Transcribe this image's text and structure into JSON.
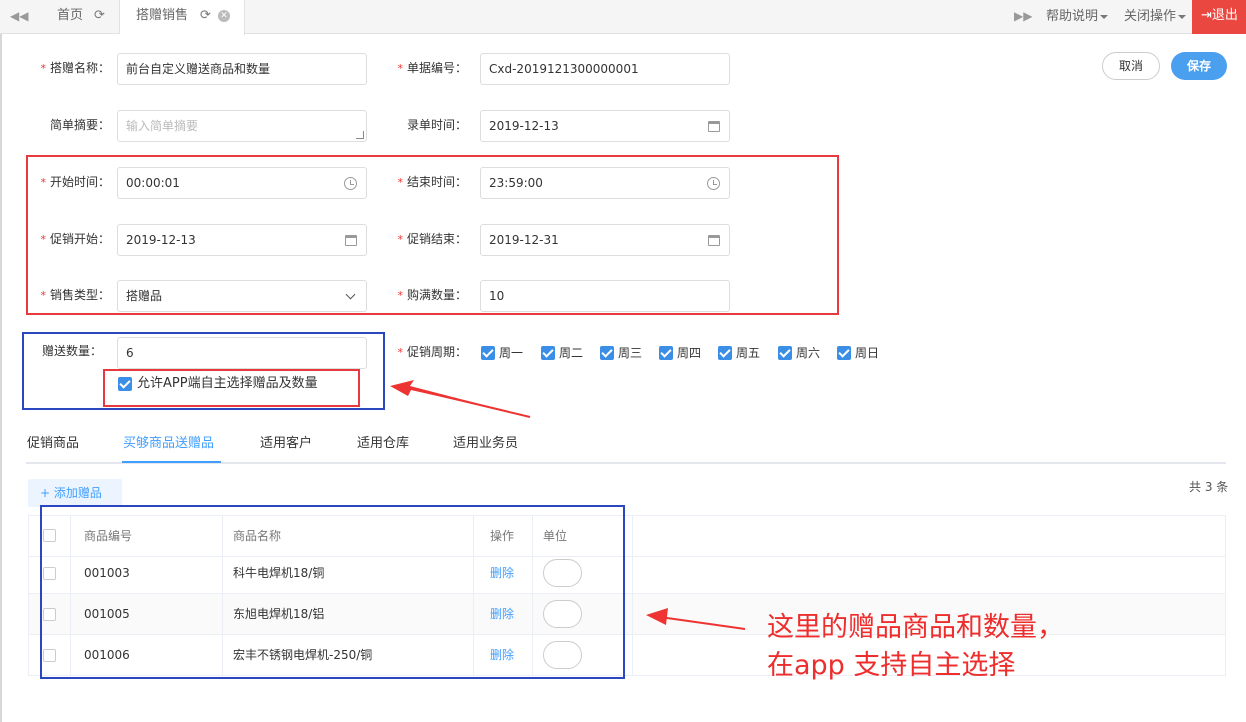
{
  "topbar": {
    "tabs": [
      {
        "label": "首页"
      },
      {
        "label": "搭赠销售"
      }
    ],
    "help_label": "帮助说明",
    "close_ops_label": "关闭操作",
    "logout_label": "退出"
  },
  "form": {
    "name": {
      "label": "搭赠名称：",
      "value": "前台自定义赠送商品和数量"
    },
    "doc_no": {
      "label": "单据编号：",
      "value": "Cxd-2019121300000001"
    },
    "summary": {
      "label": "简单摘要：",
      "placeholder": "输入简单摘要"
    },
    "record_time": {
      "label": "录单时间：",
      "value": "2019-12-13"
    },
    "start_time": {
      "label": "开始时间：",
      "value": "00:00:01"
    },
    "end_time": {
      "label": "结束时间：",
      "value": "23:59:00"
    },
    "promo_start": {
      "label": "促销开始：",
      "value": "2019-12-13"
    },
    "promo_end": {
      "label": "促销结束：",
      "value": "2019-12-31"
    },
    "sale_type": {
      "label": "销售类型：",
      "value": "搭赠品"
    },
    "buy_qty": {
      "label": "购满数量：",
      "value": "10"
    },
    "gift_qty": {
      "label": "赠送数量：",
      "value": "6"
    },
    "allow_app": {
      "label": "允许APP端自主选择赠品及数量",
      "checked": true
    },
    "promo_cycle": {
      "label": "促销周期：",
      "days": [
        {
          "label": "周一",
          "checked": true
        },
        {
          "label": "周二",
          "checked": true
        },
        {
          "label": "周三",
          "checked": true
        },
        {
          "label": "周四",
          "checked": true
        },
        {
          "label": "周五",
          "checked": true
        },
        {
          "label": "周六",
          "checked": true
        },
        {
          "label": "周日",
          "checked": true
        }
      ]
    }
  },
  "actions": {
    "cancel_label": "取消",
    "save_label": "保存"
  },
  "tabs": [
    {
      "label": "促销商品",
      "active": false
    },
    {
      "label": "买够商品送赠品",
      "active": true
    },
    {
      "label": "适用客户",
      "active": false
    },
    {
      "label": "适用仓库",
      "active": false
    },
    {
      "label": "适用业务员",
      "active": false
    }
  ],
  "gifts": {
    "add_label": "添加赠品",
    "total_label": "共 3 条",
    "columns": [
      "商品编号",
      "商品名称",
      "操作",
      "单位"
    ],
    "rows": [
      {
        "code": "001003",
        "name": "科牛电焊机18/铜",
        "action": "删除"
      },
      {
        "code": "001005",
        "name": "东旭电焊机18/铝",
        "action": "删除"
      },
      {
        "code": "001006",
        "name": "宏丰不锈钢电焊机-250/铜",
        "action": "删除"
      }
    ]
  },
  "annotation": {
    "line1": "这里的赠品商品和数量，",
    "line2": "在app 支持自主选择"
  },
  "colors": {
    "accent": "#409eff",
    "save": "#4aa0ef",
    "logout": "#e9473f",
    "required": "#e33333",
    "annotation_red": "#e8393e",
    "annotation_blue": "#2a47c0"
  }
}
